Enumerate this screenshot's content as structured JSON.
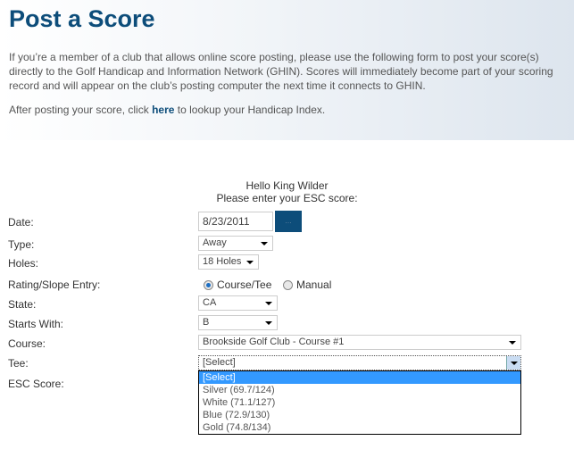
{
  "header": {
    "title": "Post a Score",
    "intro": "If you’re a member of a club that allows online score posting, please use the following form to post your score(s) directly to the Golf Handicap and Information Network (GHIN). Scores will immediately become part of your scoring record and will appear on the club’s posting computer the next time it connects to GHIN.",
    "after_pre": "After posting your score, click ",
    "after_link": "here",
    "after_post": " to lookup your Handicap Index."
  },
  "form": {
    "greeting": "Hello King Wilder",
    "prompt": "Please enter your ESC score:",
    "labels": {
      "date": "Date:",
      "type": "Type:",
      "holes": "Holes:",
      "rating": "Rating/Slope Entry:",
      "state": "State:",
      "starts": "Starts With:",
      "course": "Course:",
      "tee": "Tee:",
      "esc": "ESC Score:"
    },
    "date_value": "8/23/2011",
    "date_button": "...",
    "type_value": "Away",
    "holes_value": "18 Holes",
    "rating_options": [
      "Course/Tee",
      "Manual"
    ],
    "rating_selected": "Course/Tee",
    "state_value": "CA",
    "starts_value": "B",
    "course_value": "Brookside Golf Club - Course #1",
    "tee_value": "[Select]",
    "tee_options": [
      "[Select]",
      "Silver (69.7/124)",
      "White (71.1/127)",
      "Blue (72.9/130)",
      "Gold (74.8/134)"
    ]
  },
  "colors": {
    "accent": "#0d4d7a",
    "highlight": "#3399ff"
  }
}
